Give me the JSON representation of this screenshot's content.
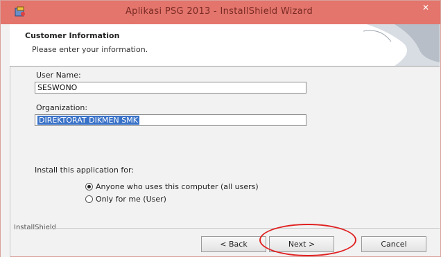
{
  "window": {
    "title": "Aplikasi PSG 2013 - InstallShield Wizard",
    "close_symbol": "✕"
  },
  "header": {
    "title": "Customer Information",
    "subtitle": "Please enter your information."
  },
  "form": {
    "user_name_label": "User Name:",
    "user_name_value": "SESWONO",
    "organization_label": "Organization:",
    "organization_value": "DIREKTORAT DIKMEN SMK"
  },
  "install_for": {
    "label": "Install this application for:",
    "options": [
      {
        "label": "Anyone who uses this computer (all users)",
        "selected": true
      },
      {
        "label": "Only for me (User)",
        "selected": false
      }
    ]
  },
  "footer": {
    "brand": "InstallShield",
    "back_label": "< Back",
    "next_label": "Next >",
    "cancel_label": "Cancel"
  },
  "colors": {
    "titlebar": "#e3756c",
    "selection": "#3a72c8",
    "annotation": "#e02020"
  }
}
